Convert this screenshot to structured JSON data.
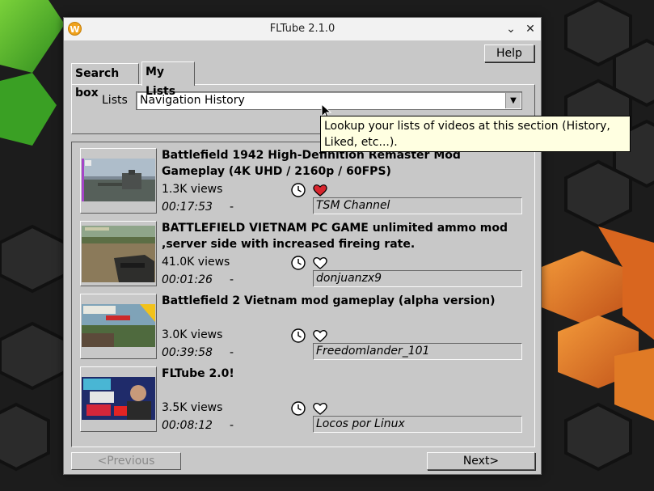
{
  "window": {
    "title": "FLTube 2.1.0",
    "logo_letter": "W"
  },
  "toolbar": {
    "help_label": "Help"
  },
  "tabs": [
    {
      "label": "Search box",
      "active": false
    },
    {
      "label": "My Lists",
      "active": true
    }
  ],
  "lists": {
    "label": "Lists",
    "selected": "Navigation History"
  },
  "tooltip": {
    "text": "Lookup your lists of videos at this section (History, Liked, etc...)."
  },
  "videos": [
    {
      "title": "Battlefield 1942 High-Definition Remaster Mod Gameplay (4K UHD / 2160p / 60FPS)",
      "views": "1.3K views",
      "duration": "00:17:53",
      "separator": "-",
      "channel": "TSM Channel",
      "liked": true
    },
    {
      "title": "BATTLEFIELD VIETNAM PC GAME unlimited ammo mod ,server side with increased fireing rate.",
      "views": "41.0K views",
      "duration": "00:01:26",
      "separator": "-",
      "channel": "donjuanzx9",
      "liked": false
    },
    {
      "title": "Battlefield 2 Vietnam mod gameplay (alpha version)",
      "views": "3.0K views",
      "duration": "00:39:58",
      "separator": "-",
      "channel": "Freedomlander_101",
      "liked": false
    },
    {
      "title": "FLTube 2.0!",
      "views": "3.5K views",
      "duration": "00:08:12",
      "separator": "-",
      "channel": "Locos por Linux",
      "liked": false
    }
  ],
  "pagination": {
    "previous_label": "<Previous",
    "next_label": "Next>"
  },
  "colors": {
    "heart_liked": "#d7262e",
    "tooltip_bg": "#ffffe1",
    "window_bg": "#c8c8c8",
    "accent_green": "#5fbf2a",
    "accent_orange": "#e8781e"
  },
  "icons": {
    "clock": "clock-icon",
    "heart": "heart-icon",
    "close": "close-icon",
    "minimize": "chevron-down-icon"
  }
}
